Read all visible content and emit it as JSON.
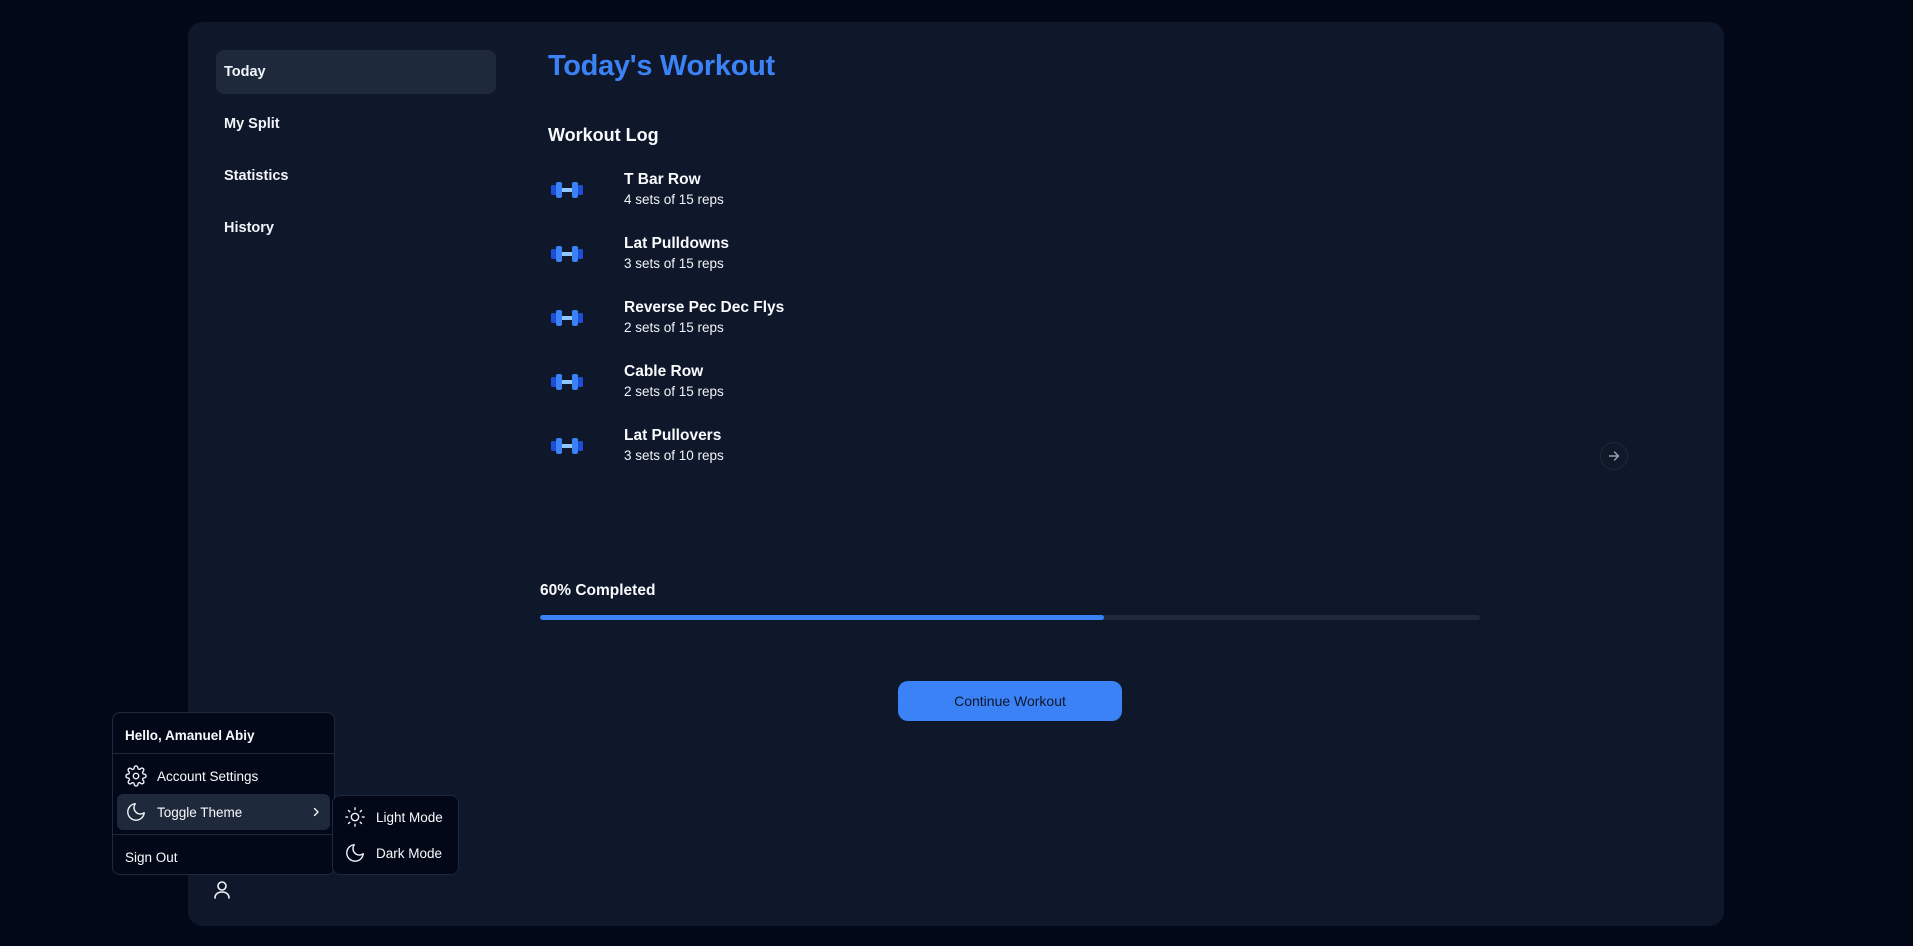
{
  "sidebar": {
    "items": [
      {
        "label": "Today",
        "active": true
      },
      {
        "label": "My Split"
      },
      {
        "label": "Statistics"
      },
      {
        "label": "History"
      }
    ]
  },
  "main": {
    "title": "Today's Workout",
    "log_title": "Workout Log",
    "exercises": [
      {
        "name": "T Bar Row",
        "detail": "4 sets of 15 reps",
        "icon": "dumbbell-icon"
      },
      {
        "name": "Lat Pulldowns",
        "detail": "3 sets of 15 reps",
        "icon": "dumbbell-icon"
      },
      {
        "name": "Reverse Pec Dec Flys",
        "detail": "2 sets of 15 reps",
        "icon": "dumbbell-icon"
      },
      {
        "name": "Cable Row",
        "detail": "2 sets of 15 reps",
        "icon": "dumbbell-icon"
      },
      {
        "name": "Lat Pullovers",
        "detail": "3 sets of 10 reps",
        "icon": "dumbbell-icon"
      }
    ],
    "next_icon": "arrow-right-icon",
    "progress": {
      "label": "60% Completed",
      "value": 0.6
    },
    "continue_label": "Continue Workout"
  },
  "user_menu": {
    "greeting": "Hello, Amanuel Abiy",
    "account_settings": "Account Settings",
    "toggle_theme": "Toggle Theme",
    "sign_out": "Sign Out",
    "theme_options": {
      "light": "Light Mode",
      "dark": "Dark Mode"
    }
  },
  "colors": {
    "background": "#020817",
    "card": "#0f172a",
    "accent": "#3b82f6",
    "muted": "#1e293b"
  }
}
